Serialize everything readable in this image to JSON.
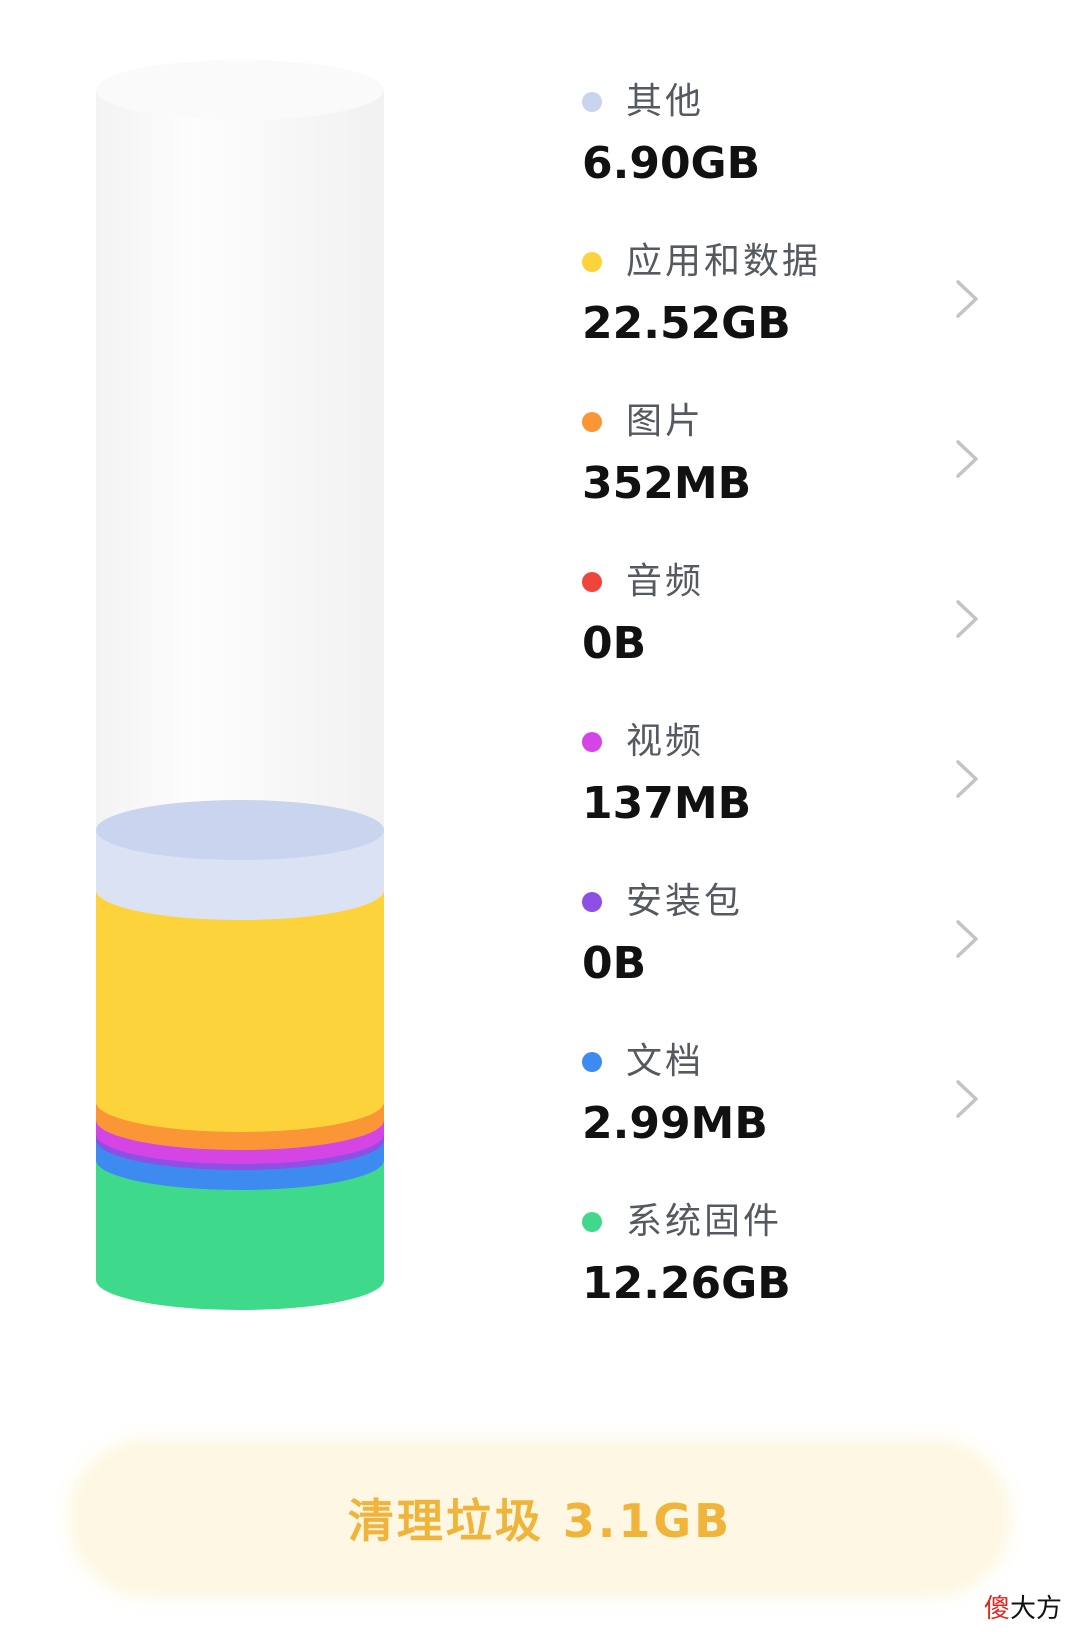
{
  "storage": {
    "items": [
      {
        "key": "other",
        "label": "其他",
        "value": "6.90GB",
        "color": "#c9d4ee",
        "has_chevron": false
      },
      {
        "key": "apps",
        "label": "应用和数据",
        "value": "22.52GB",
        "color": "#fdd33c",
        "has_chevron": true
      },
      {
        "key": "images",
        "label": "图片",
        "value": "352MB",
        "color": "#fa9635",
        "has_chevron": true
      },
      {
        "key": "audio",
        "label": "音频",
        "value": "0B",
        "color": "#f0453a",
        "has_chevron": true
      },
      {
        "key": "video",
        "label": "视频",
        "value": "137MB",
        "color": "#d545e6",
        "has_chevron": true
      },
      {
        "key": "apk",
        "label": "安装包",
        "value": "0B",
        "color": "#8d4fe4",
        "has_chevron": true
      },
      {
        "key": "documents",
        "label": "文档",
        "value": "2.99MB",
        "color": "#3d8bf0",
        "has_chevron": true
      },
      {
        "key": "system",
        "label": "系统固件",
        "value": "12.26GB",
        "color": "#3fd98c",
        "has_chevron": false
      }
    ]
  },
  "clean_button": {
    "label": "清理垃圾 3.1GB",
    "color": "#f0b43a"
  },
  "watermark": {
    "first": "傻",
    "rest": "大方"
  },
  "colors": {
    "cylinder_empty": "#f6f6f6",
    "chevron": "#c4c4c4",
    "button_bg": "#fdf7e4"
  }
}
